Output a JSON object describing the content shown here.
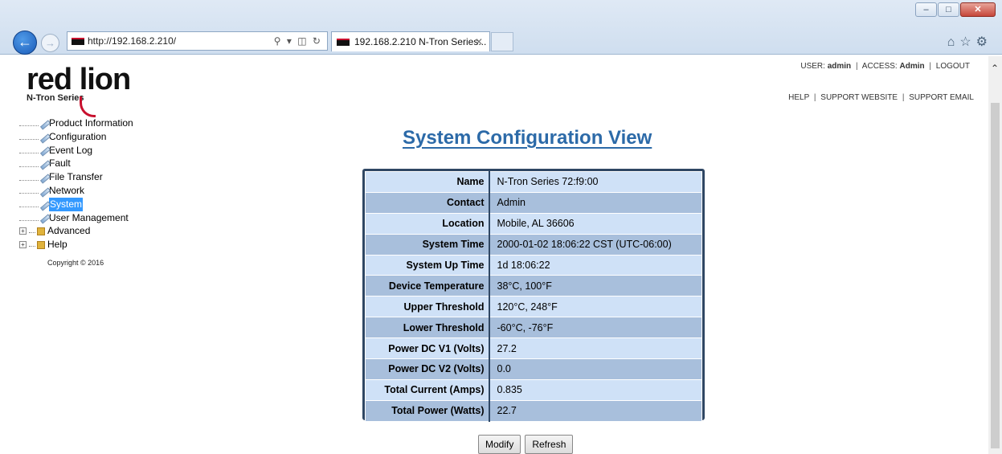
{
  "browser": {
    "url": "http://192.168.2.210/",
    "url_host": "192.168.2.210",
    "tab_title": "192.168.2.210 N-Tron Series..."
  },
  "logo": {
    "brand": "red lion",
    "sub": "N-Tron Series"
  },
  "header": {
    "user_label": "USER:",
    "user": "admin",
    "access_label": "ACCESS:",
    "access": "Admin",
    "logout": "LOGOUT",
    "help": "HELP",
    "support_website": "SUPPORT WEBSITE",
    "support_email": "SUPPORT EMAIL"
  },
  "nav": {
    "items": [
      "Product Information",
      "Configuration",
      "Event Log",
      "Fault",
      "File Transfer",
      "Network",
      "System",
      "User Management"
    ],
    "selected": "System",
    "folders": [
      "Advanced",
      "Help"
    ],
    "copyright": "Copyright © 2016"
  },
  "page": {
    "title": "System Configuration View"
  },
  "config": [
    {
      "key": "Name",
      "value": "N-Tron Series 72:f9:00"
    },
    {
      "key": "Contact",
      "value": "Admin"
    },
    {
      "key": "Location",
      "value": "Mobile, AL 36606"
    },
    {
      "key": "System Time",
      "value": "2000-01-02 18:06:22 CST (UTC-06:00)"
    },
    {
      "key": "System Up Time",
      "value": "1d 18:06:22"
    },
    {
      "key": "Device Temperature",
      "value": "38°C, 100°F"
    },
    {
      "key": "Upper Threshold",
      "value": "120°C, 248°F"
    },
    {
      "key": "Lower Threshold",
      "value": "-60°C, -76°F"
    },
    {
      "key": "Power DC V1 (Volts)",
      "value": "27.2"
    },
    {
      "key": "Power DC V2 (Volts)",
      "value": "0.0"
    },
    {
      "key": "Total Current (Amps)",
      "value": "0.835"
    },
    {
      "key": "Total Power (Watts)",
      "value": "22.7"
    }
  ],
  "buttons": {
    "modify": "Modify",
    "refresh": "Refresh"
  },
  "colors": {
    "title": "#2c6aa8",
    "row_light": "#cfe1f7",
    "row_dark": "#a8bfdc",
    "border": "#2f4764",
    "selected": "#3399ff"
  }
}
